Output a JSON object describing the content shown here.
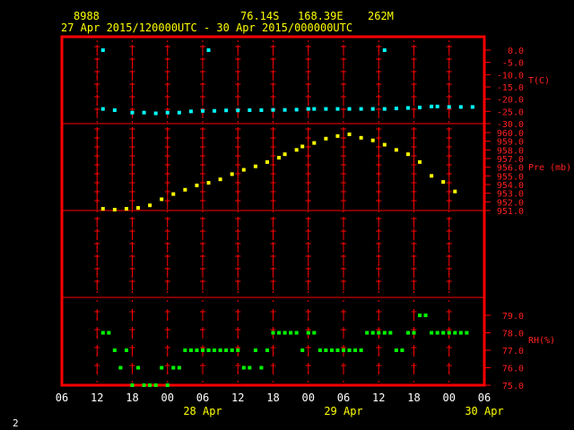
{
  "header": {
    "station_id": "8988",
    "latitude": "76.14S",
    "longitude": "168.39E",
    "elevation": "262M",
    "time_range": "27 Apr 2015/120000UTC - 30 Apr 2015/000000UTC"
  },
  "corner_label": "2",
  "colors": {
    "frame": "#ff0000",
    "temperature": "#00ffff",
    "pressure": "#ffff00",
    "rh": "#00ff00",
    "tick_text": "#ff2020"
  },
  "chart_data": [
    {
      "type": "scatter",
      "ylabel": "T(C)",
      "ylim": [
        -30,
        0
      ],
      "yticks": [
        "0.0",
        "-5.0",
        "-10.0",
        "-15.0",
        "-20.0",
        "-25.0",
        "-30.0"
      ],
      "xlim": [
        -6,
        66
      ],
      "x": [
        1,
        3,
        6,
        8,
        10,
        12,
        14,
        16,
        18,
        20,
        22,
        24,
        26,
        28,
        30,
        32,
        34,
        36,
        37,
        39,
        41,
        43,
        45,
        47,
        49,
        51,
        53,
        55,
        57,
        58,
        60,
        62,
        64
      ],
      "values": [
        -24,
        -24.5,
        -25.5,
        -25.5,
        -25.8,
        -25.5,
        -25.5,
        -25,
        -24.8,
        -24.8,
        -24.6,
        -24.6,
        -24.5,
        -24.5,
        -24.4,
        -24.4,
        -24.3,
        -24,
        -24,
        -24,
        -24,
        -24,
        -24,
        -24,
        -24,
        -23.8,
        -23.6,
        -23.4,
        -23,
        -23,
        -23.2,
        -23.2,
        -23.2
      ],
      "outliers": [
        {
          "x": 1,
          "y": 0
        },
        {
          "x": 19,
          "y": 0
        },
        {
          "x": 49,
          "y": 0
        }
      ]
    },
    {
      "type": "scatter",
      "ylabel": "Pre (mb)",
      "ylim": [
        951,
        960
      ],
      "yticks": [
        "960.0",
        "959.0",
        "958.0",
        "957.0",
        "956.0",
        "955.0",
        "954.0",
        "953.0",
        "952.0",
        "951.0"
      ],
      "xlim": [
        -6,
        66
      ],
      "x": [
        1,
        3,
        5,
        7,
        9,
        11,
        13,
        15,
        17,
        19,
        21,
        23,
        25,
        27,
        29,
        31,
        32,
        34,
        35,
        37,
        39,
        41,
        43,
        45,
        47,
        49,
        51,
        53,
        55,
        57,
        59,
        61
      ],
      "values": [
        951.2,
        951.1,
        951.2,
        951.3,
        951.6,
        952.3,
        952.9,
        953.4,
        953.9,
        954.2,
        954.6,
        955.2,
        955.7,
        956.1,
        956.6,
        957.1,
        957.5,
        958.0,
        958.4,
        958.8,
        959.3,
        959.6,
        959.8,
        959.4,
        959.1,
        958.6,
        958.0,
        957.5,
        956.6,
        955.0,
        954.3,
        953.2
      ]
    },
    {
      "type": "scatter",
      "ylabel": "RH(%)",
      "ylim": [
        75,
        79
      ],
      "yticks": [
        "79.0",
        "78.0",
        "77.0",
        "76.0",
        "75.0"
      ],
      "xlim": [
        -6,
        66
      ],
      "x": [
        1,
        2,
        3,
        4,
        5,
        6,
        7,
        8,
        9,
        10,
        11,
        12,
        13,
        14,
        15,
        16,
        17,
        18,
        19,
        20,
        21,
        22,
        23,
        24,
        25,
        26,
        27,
        28,
        29,
        30,
        31,
        32,
        33,
        34,
        35,
        36,
        37,
        38,
        39,
        40,
        41,
        42,
        43,
        44,
        45,
        46,
        47,
        48,
        49,
        50,
        51,
        52,
        53,
        54,
        55,
        56,
        57,
        58,
        59,
        60,
        61,
        62,
        63
      ],
      "values": [
        78,
        78,
        77,
        76,
        77,
        75,
        76,
        75,
        75,
        75,
        76,
        75,
        76,
        76,
        77,
        77,
        77,
        77,
        77,
        77,
        77,
        77,
        77,
        77,
        76,
        76,
        77,
        76,
        77,
        78,
        78,
        78,
        78,
        78,
        77,
        78,
        78,
        77,
        77,
        77,
        77,
        77,
        77,
        77,
        77,
        78,
        78,
        78,
        78,
        78,
        77,
        77,
        78,
        78,
        79,
        79,
        78,
        78,
        78,
        78,
        78,
        78,
        78
      ]
    }
  ],
  "xaxis": {
    "ticks": [
      "06",
      "12",
      "18",
      "00",
      "06",
      "12",
      "18",
      "00",
      "06",
      "12",
      "18",
      "00",
      "06"
    ],
    "dates": [
      "28 Apr",
      "29 Apr",
      "30 Apr"
    ]
  }
}
